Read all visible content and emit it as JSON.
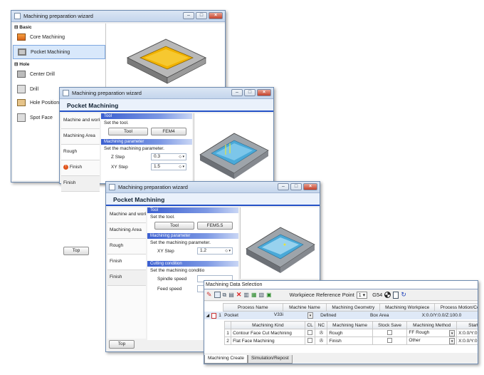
{
  "window_title": "Machining preparation wizard",
  "win1": {
    "groups": [
      {
        "label": "Basic",
        "items": [
          {
            "label": "Core Machining"
          },
          {
            "label": "Pocket Machining"
          }
        ]
      },
      {
        "label": "Hole",
        "items": [
          {
            "label": "Center Drill"
          },
          {
            "label": "Drill"
          },
          {
            "label": "Hole Position"
          },
          {
            "label": "Spot Face"
          }
        ]
      }
    ]
  },
  "win2": {
    "header": "Pocket Machining",
    "nav": [
      "Machine and work",
      "Machining Area",
      "Rough",
      "Finish",
      "Finish"
    ],
    "tool_section": "Tool",
    "tool_prompt": "Set the tool.",
    "tool_button": "Tool",
    "tool_value": "FEM4",
    "param_section": "Machining parameter",
    "param_prompt": "Set the machining parameter.",
    "z_step_label": "Z Step",
    "z_step_value": "0.3",
    "xy_step_label": "XY Step",
    "xy_step_value": "1.5",
    "top_button": "Top"
  },
  "win3": {
    "header": "Pocket Machining",
    "nav": [
      "Machine and work",
      "Machining Area",
      "Rough",
      "Finish",
      "Finish"
    ],
    "tool_section": "Tool",
    "tool_prompt": "Set the tool.",
    "tool_button": "Tool",
    "tool_value": "FEM5.5",
    "param_section": "Machining parameter",
    "param_prompt": "Set the machining parameter.",
    "xy_step_label": "XY Step",
    "xy_step_value": "1.2",
    "cutting_section": "Cutting condition",
    "cutting_prompt": "Set the machining conditio",
    "spindle_label": "Spindle speed",
    "feed_label": "Feed speed",
    "top_button": "Top"
  },
  "datawin": {
    "title": "Machining Data Selection",
    "toolbar_label": "Workpiece Reference Point",
    "ref_point_value": "1",
    "g_code": "G54",
    "process_headers": [
      "Process Name",
      "Machine Name",
      "Machining Geometry",
      "Machining Workpiece",
      "Process Motion/Comm"
    ],
    "process_row": {
      "index": "1",
      "name": "Pocket",
      "machine": "V33i",
      "geometry": "Defined",
      "workpiece": "Box Area",
      "motion": "X:0.0/Y:0.0/Z:100.0"
    },
    "kind_headers": [
      "Machining Kind",
      "CL",
      "NC",
      "Machining Name",
      "Stock Save",
      "Machining Method",
      "Start P"
    ],
    "kind_rows": [
      {
        "index": "1",
        "kind": "Contour Face Cut Machining",
        "name": "Rough",
        "method": "FF Rough",
        "start": "X:0.0/Y:0."
      },
      {
        "index": "2",
        "kind": "Flat Face Machining",
        "name": "Finish",
        "method": "Other",
        "start": "X:0.0/Y:0."
      }
    ],
    "tabs": [
      "Machining Create",
      "Simulation/Repost"
    ]
  }
}
